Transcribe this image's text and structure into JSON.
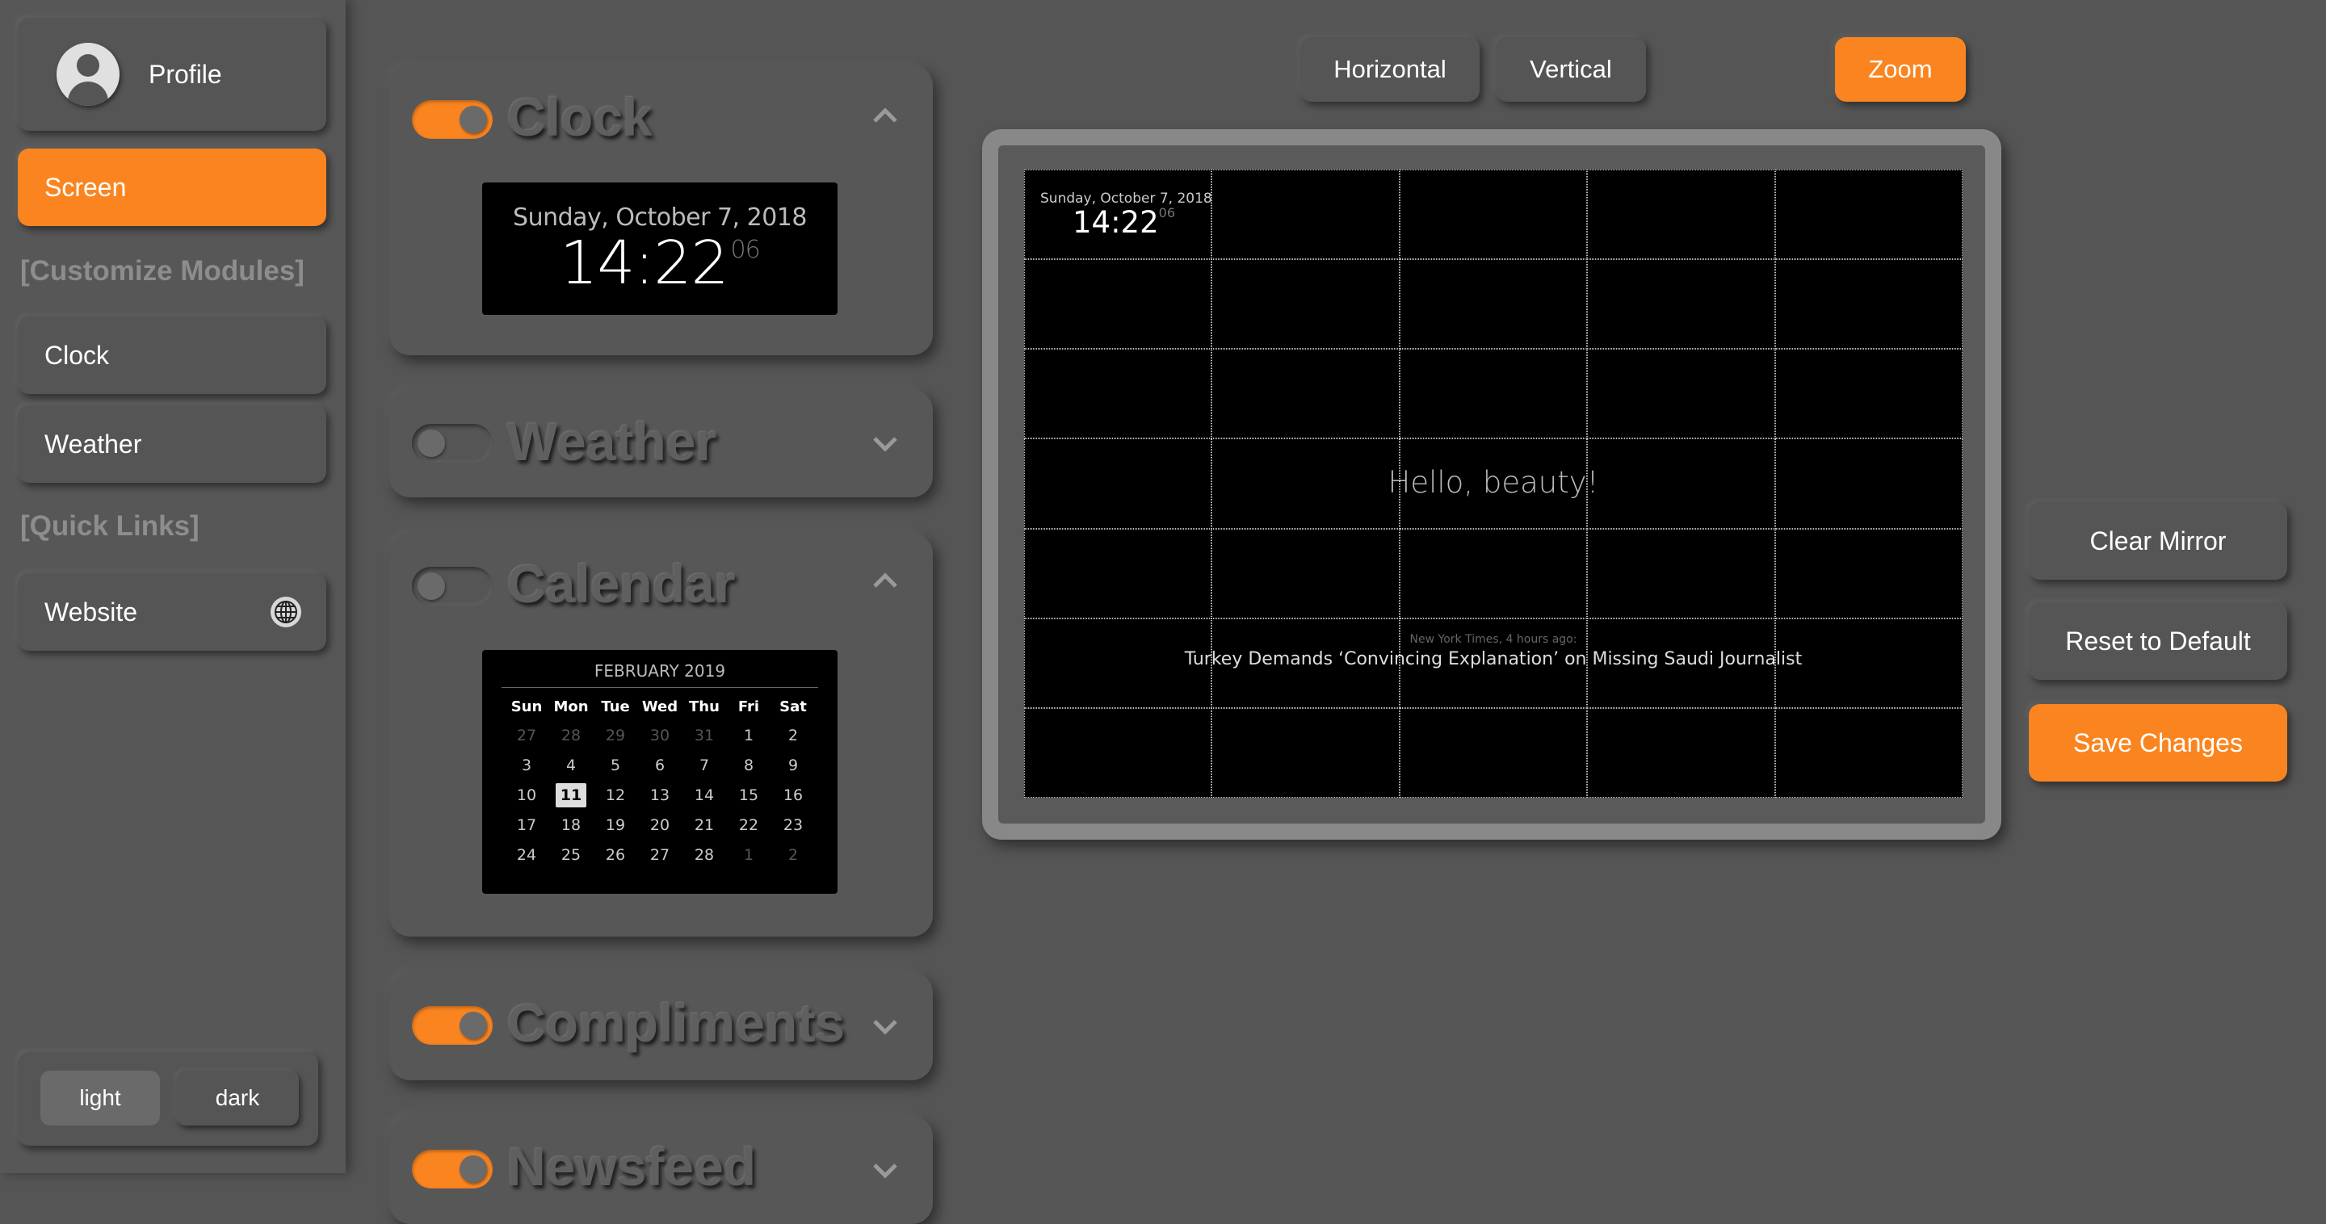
{
  "sidebar": {
    "profile_label": "Profile",
    "screen_label": "Screen",
    "customize_heading": "[Customize Modules]",
    "clock_label": "Clock",
    "weather_label": "Weather",
    "quicklinks_heading": "[Quick Links]",
    "website_label": "Website",
    "theme_light": "light",
    "theme_dark": "dark"
  },
  "colors": {
    "accent": "#fa8520",
    "background": "#555555",
    "mirror_bg": "#000000"
  },
  "modules": {
    "clock": {
      "title": "Clock",
      "enabled": true,
      "expanded": true,
      "date": "Sunday, October 7, 2018",
      "time": "14:22",
      "seconds": "06"
    },
    "weather": {
      "title": "Weather",
      "enabled": false,
      "expanded": false
    },
    "calendar": {
      "title": "Calendar",
      "enabled": false,
      "expanded": true,
      "month": "FEBRUARY 2019",
      "weekdays": [
        "Sun",
        "Mon",
        "Tue",
        "Wed",
        "Thu",
        "Fri",
        "Sat"
      ],
      "weeks": [
        [
          "27",
          "28",
          "29",
          "30",
          "31",
          "1",
          "2"
        ],
        [
          "3",
          "4",
          "5",
          "6",
          "7",
          "8",
          "9"
        ],
        [
          "10",
          "11",
          "12",
          "13",
          "14",
          "15",
          "16"
        ],
        [
          "17",
          "18",
          "19",
          "20",
          "21",
          "22",
          "23"
        ],
        [
          "24",
          "25",
          "26",
          "27",
          "28",
          "1",
          "2"
        ]
      ],
      "today": "11"
    },
    "compliments": {
      "title": "Compliments",
      "enabled": true,
      "expanded": false
    },
    "newsfeed": {
      "title": "Newsfeed",
      "enabled": true,
      "expanded": false
    }
  },
  "view_tabs": {
    "horizontal": "Horizontal",
    "vertical": "Vertical",
    "zoom": "Zoom"
  },
  "mirror": {
    "clock_date": "Sunday, October 7, 2018",
    "clock_time": "14:22",
    "clock_seconds": "06",
    "compliment": "Hello, beauty!",
    "news_source": "New York Times, 4 hours ago:",
    "news_headline": "Turkey Demands ‘Convincing Explanation’ on Missing Saudi Journalist"
  },
  "actions": {
    "clear": "Clear Mirror",
    "reset": "Reset to Default",
    "save": "Save Changes"
  }
}
